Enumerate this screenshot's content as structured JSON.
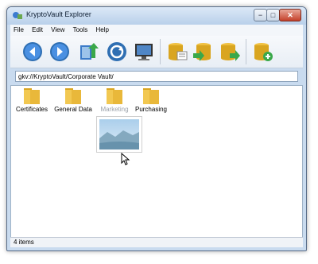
{
  "window": {
    "title": "KryptoVault Explorer",
    "controls": {
      "minimize": "−",
      "maximize": "□",
      "close": "✕"
    }
  },
  "menu": [
    "File",
    "Edit",
    "View",
    "Tools",
    "Help"
  ],
  "toolbar": {
    "buttons": [
      {
        "icon": "back-arrow-icon"
      },
      {
        "icon": "forward-arrow-icon"
      },
      {
        "icon": "up-folder-icon"
      },
      {
        "icon": "refresh-icon"
      },
      {
        "icon": "monitor-icon"
      },
      {
        "icon": "database-icon"
      },
      {
        "icon": "database-download-icon"
      },
      {
        "icon": "database-upload-icon"
      },
      {
        "icon": "database-add-icon"
      }
    ]
  },
  "address": {
    "value": "gkv://KryptoVault/Corporate Vault/"
  },
  "folders": [
    {
      "label": "Certificates"
    },
    {
      "label": "General Data"
    },
    {
      "label": "Marketing"
    },
    {
      "label": "Purchasing"
    }
  ],
  "status": {
    "text": "4 items"
  },
  "colors": {
    "folder": "#f2c851",
    "accent": "#2f6fb3"
  }
}
